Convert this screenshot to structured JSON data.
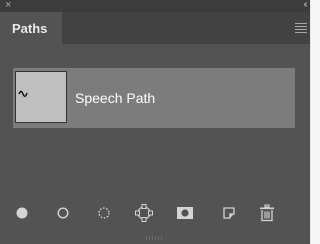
{
  "window": {
    "close_icon": "×",
    "collapse_icon": "‹‹"
  },
  "tabs": [
    {
      "label": "Paths",
      "active": true
    }
  ],
  "panel_menu_icon": "hamburger-menu-icon",
  "paths": [
    {
      "label": "Speech Path",
      "selected": true
    }
  ],
  "toolbar": [
    {
      "name": "fill-path-icon",
      "tooltip": "Fill path with foreground color"
    },
    {
      "name": "stroke-path-icon",
      "tooltip": "Stroke path with brush"
    },
    {
      "name": "load-as-selection-icon",
      "tooltip": "Load path as a selection"
    },
    {
      "name": "make-work-path-icon",
      "tooltip": "Make work path from selection"
    },
    {
      "name": "add-mask-icon",
      "tooltip": "Add a mask"
    },
    {
      "name": "new-path-icon",
      "tooltip": "Create new path"
    },
    {
      "name": "delete-path-icon",
      "tooltip": "Delete current path"
    }
  ],
  "colors": {
    "panel_bg": "#535353",
    "tab_bar_bg": "#424242",
    "selected_row": "#7c7c7c",
    "icon": "#d4d4d4"
  }
}
